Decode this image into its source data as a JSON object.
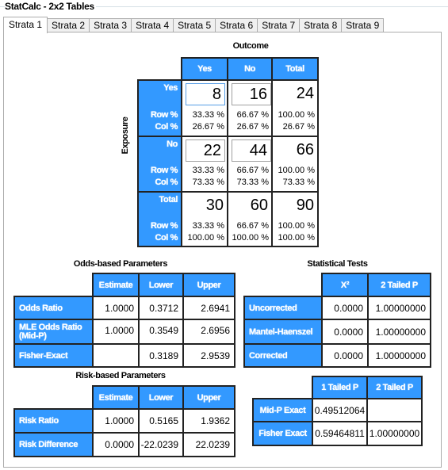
{
  "window": {
    "group_title": "StatCalc - 2x2 Tables"
  },
  "tabs": [
    {
      "label": "Strata 1",
      "active": true
    },
    {
      "label": "Strata 2"
    },
    {
      "label": "Strata 3"
    },
    {
      "label": "Strata 4"
    },
    {
      "label": "Strata 5"
    },
    {
      "label": "Strata 6"
    },
    {
      "label": "Strata 7"
    },
    {
      "label": "Strata 8"
    },
    {
      "label": "Strata 9"
    }
  ],
  "table2x2": {
    "outcome_label": "Outcome",
    "exposure_label": "Exposure",
    "col_headers": [
      "Yes",
      "No",
      "Total"
    ],
    "row_pct_label": "Row %",
    "col_pct_label": "Col %",
    "rows": [
      {
        "label": "Yes",
        "values": [
          "8",
          "16",
          "24"
        ],
        "row_pct": [
          "33.33 %",
          "66.67 %",
          "100.00 %"
        ],
        "col_pct": [
          "26.67 %",
          "26.67 %",
          "26.67 %"
        ]
      },
      {
        "label": "No",
        "values": [
          "22",
          "44",
          "66"
        ],
        "row_pct": [
          "33.33 %",
          "66.67 %",
          "100.00 %"
        ],
        "col_pct": [
          "73.33 %",
          "73.33 %",
          "73.33 %"
        ]
      },
      {
        "label": "Total",
        "values": [
          "30",
          "60",
          "90"
        ],
        "row_pct": [
          "33.33 %",
          "66.67 %",
          "100.00 %"
        ],
        "col_pct": [
          "100.00 %",
          "100.00 %",
          "100.00 %"
        ]
      }
    ]
  },
  "odds": {
    "title": "Odds-based Parameters",
    "headers": [
      "Estimate",
      "Lower",
      "Upper"
    ],
    "rows": [
      {
        "label": "Odds Ratio",
        "values": [
          "1.0000",
          "0.3712",
          "2.6941"
        ]
      },
      {
        "label": "MLE Odds Ratio (Mid-P)",
        "values": [
          "1.0000",
          "0.3549",
          "2.6956"
        ]
      },
      {
        "label": "Fisher-Exact",
        "values": [
          "",
          "0.3189",
          "2.9539"
        ]
      }
    ]
  },
  "tests": {
    "title": "Statistical Tests",
    "headers": [
      "X²",
      "2 Tailed P"
    ],
    "rows": [
      {
        "label": "Uncorrected",
        "values": [
          "0.0000",
          "1.00000000"
        ]
      },
      {
        "label": "Mantel-Haenszel",
        "values": [
          "0.0000",
          "1.00000000"
        ]
      },
      {
        "label": "Corrected",
        "values": [
          "0.0000",
          "1.00000000"
        ]
      }
    ]
  },
  "risk": {
    "title": "Risk-based Parameters",
    "headers": [
      "Estimate",
      "Lower",
      "Upper"
    ],
    "rows": [
      {
        "label": "Risk Ratio",
        "values": [
          "1.0000",
          "0.5165",
          "1.9362"
        ]
      },
      {
        "label": "Risk Difference",
        "values": [
          "0.0000",
          "-22.0239",
          "22.0239"
        ]
      }
    ]
  },
  "exact": {
    "headers": [
      "1 Tailed P",
      "2 Tailed P"
    ],
    "rows": [
      {
        "label": "Mid-P Exact",
        "values": [
          "0.49512064",
          ""
        ]
      },
      {
        "label": "Fisher Exact",
        "values": [
          "0.59464811",
          "1.00000000"
        ]
      }
    ]
  },
  "colors": {
    "header_blue": "#3399ff",
    "border_dark": "#222222"
  }
}
